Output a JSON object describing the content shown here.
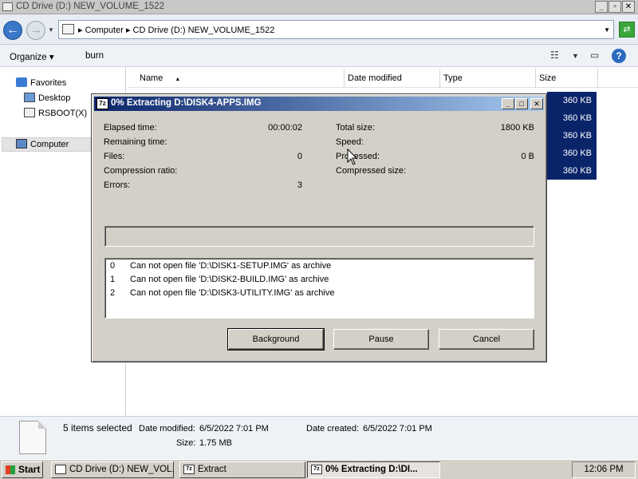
{
  "explorer": {
    "title": "CD Drive (D:) NEW_VOLUME_1522",
    "breadcrumb": [
      "Computer",
      "CD Drive (D:) NEW_VOLUME_1522"
    ],
    "toolbar": {
      "organize": "Organize",
      "burn": "burn"
    },
    "nav": {
      "favorites": "Favorites",
      "desktop": "Desktop",
      "rsboot": "RSBOOT(X)",
      "computer": "Computer"
    },
    "columns": {
      "name": "Name",
      "date_modified": "Date modified",
      "type": "Type",
      "size": "Size"
    },
    "file_sizes": [
      "360 KB",
      "360 KB",
      "360 KB",
      "360 KB",
      "360 KB"
    ],
    "details": {
      "selected": "5 items selected",
      "date_modified_label": "Date modified:",
      "date_modified": "6/5/2022 7:01 PM",
      "date_created_label": "Date created:",
      "date_created": "6/5/2022 7:01 PM",
      "size_label": "Size:",
      "size": "1.75 MB"
    }
  },
  "dialog": {
    "icon_text": "7z",
    "title": "0% Extracting D:\\DISK4-APPS.IMG",
    "progress_fraction": 0,
    "labels": {
      "elapsed": "Elapsed time:",
      "remaining": "Remaining time:",
      "files": "Files:",
      "ratio": "Compression ratio:",
      "errors": "Errors:",
      "total_size": "Total size:",
      "speed": "Speed:",
      "processed": "Processed:",
      "compressed": "Compressed size:"
    },
    "values": {
      "elapsed": "00:00:02",
      "files": "0",
      "errors": "3",
      "total_size": "1800 KB",
      "processed": "0 B"
    },
    "messages": [
      {
        "num": "0",
        "text": "Can not open file 'D:\\DISK1-SETUP.IMG' as archive"
      },
      {
        "num": "1",
        "text": "Can not open file 'D:\\DISK2-BUILD.IMG' as archive"
      },
      {
        "num": "2",
        "text": "Can not open file 'D:\\DISK3-UTILITY.IMG' as archive"
      }
    ],
    "buttons": {
      "background": "Background",
      "pause": "Pause",
      "cancel": "Cancel"
    }
  },
  "taskbar": {
    "start": "Start",
    "tasks": [
      {
        "label": "CD Drive (D:) NEW_VOL...",
        "icon": "drive-icon"
      },
      {
        "label": "Extract",
        "icon": "7zip-icon"
      },
      {
        "label": "0% Extracting D:\\DI...",
        "icon": "7zip-icon"
      }
    ],
    "clock": "12:06 PM"
  }
}
